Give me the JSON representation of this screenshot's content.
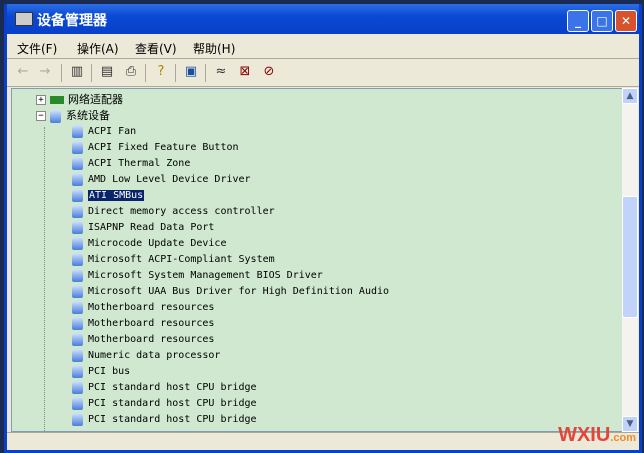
{
  "window": {
    "title": "设备管理器",
    "minimize": "_",
    "maximize": "□",
    "close": "✕"
  },
  "menu": [
    "文件(F)",
    "操作(A)",
    "查看(V)",
    "帮助(H)"
  ],
  "toolbar": [
    "back-icon",
    "forward-icon",
    "show-hide-tree-icon",
    "properties-icon",
    "print-icon",
    "help-icon",
    "scan-hardware-icon",
    "update-driver-icon",
    "uninstall-icon",
    "disable-icon"
  ],
  "tree": {
    "network": "网络适配器",
    "system": "系统设备",
    "devices": [
      "ACPI Fan",
      "ACPI Fixed Feature Button",
      "ACPI Thermal Zone",
      "AMD Low Level Device Driver",
      "ATI SMBus",
      "Direct memory access controller",
      "ISAPNP Read Data Port",
      "Microcode Update Device",
      "Microsoft ACPI-Compliant System",
      "Microsoft System Management BIOS Driver",
      "Microsoft UAA Bus Driver for High Definition Audio",
      "Motherboard resources",
      "Motherboard resources",
      "Motherboard resources",
      "Numeric data processor",
      "PCI bus",
      "PCI standard host CPU bridge",
      "PCI standard host CPU bridge",
      "PCI standard host CPU bridge"
    ],
    "selected_index": 4
  },
  "watermark": {
    "main": "WXIU",
    "suffix": ".com"
  }
}
